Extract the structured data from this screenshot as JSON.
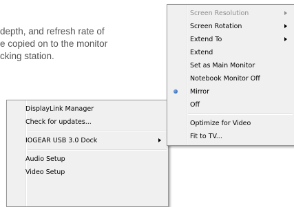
{
  "background_text": {
    "line1": "depth, and refresh rate of",
    "line2": "e copied on to the monitor",
    "line3": "cking station."
  },
  "left_menu": {
    "items": [
      {
        "label": "DisplayLink Manager"
      },
      {
        "label": "Check for updates..."
      },
      {
        "label": "IOGEAR  USB 3.0 Dock",
        "submenu": true
      },
      {
        "label": "Audio Setup"
      },
      {
        "label": "Video Setup"
      }
    ]
  },
  "right_menu": {
    "items": [
      {
        "label": "Screen Resolution",
        "submenu": true,
        "disabled": true
      },
      {
        "label": "Screen Rotation",
        "submenu": true
      },
      {
        "label": "Extend To",
        "submenu": true
      },
      {
        "label": "Extend"
      },
      {
        "label": "Set as Main Monitor"
      },
      {
        "label": "Notebook Monitor Off"
      },
      {
        "label": "Mirror",
        "selected": true
      },
      {
        "label": "Off"
      },
      {
        "label": "Optimize for Video"
      },
      {
        "label": "Fit to TV..."
      }
    ]
  },
  "colors": {
    "menu_bg": "#f0f0f0",
    "menu_border": "#979797",
    "disabled_text": "#8d8d8d",
    "radio_accent": "#2a5fb0"
  },
  "icons": {
    "submenu": "chevron-right-icon",
    "selected": "radio-dot-icon"
  }
}
